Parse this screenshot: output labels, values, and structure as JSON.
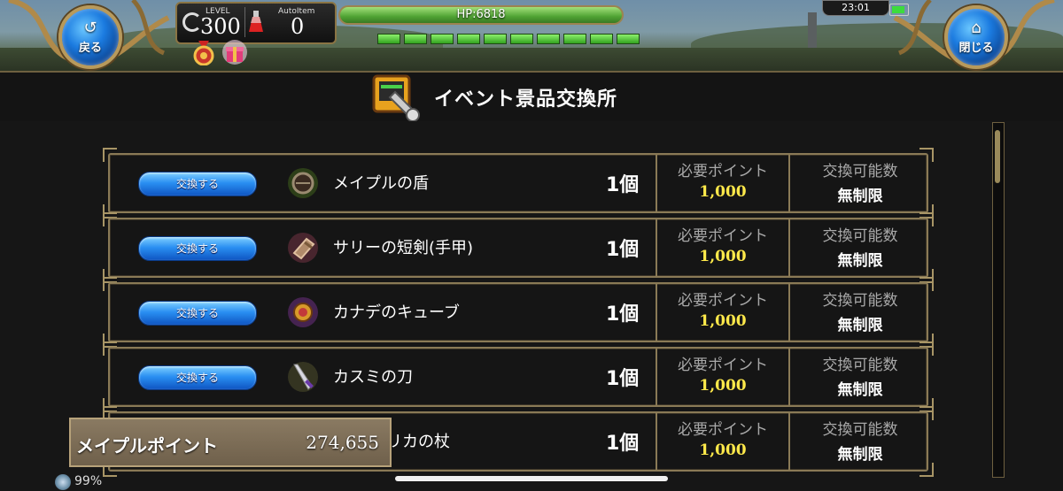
{
  "hud": {
    "back_label": "戻る",
    "close_label": "閉じる",
    "level_label": "LEVEL",
    "level_value": "300",
    "autoitem_label": "AutoItem",
    "autoitem_value": "0",
    "hp_text": "HP:6818",
    "hp_segments": 10,
    "time": "23:01"
  },
  "title": "イベント景品交換所",
  "rows": [
    {
      "button": "交換する",
      "name": "メイプルの盾",
      "qty": "1個",
      "points_header": "必要ポイント",
      "points": "1,000",
      "limit_header": "交換可能数",
      "limit": "無制限",
      "icon": "shield-icon"
    },
    {
      "button": "交換する",
      "name": "サリーの短剣(手甲)",
      "qty": "1個",
      "points_header": "必要ポイント",
      "points": "1,000",
      "limit_header": "交換可能数",
      "limit": "無制限",
      "icon": "gauntlet-icon"
    },
    {
      "button": "交換する",
      "name": "カナデのキューブ",
      "qty": "1個",
      "points_header": "必要ポイント",
      "points": "1,000",
      "limit_header": "交換可能数",
      "limit": "無制限",
      "icon": "cube-icon"
    },
    {
      "button": "交換する",
      "name": "カスミの刀",
      "qty": "1個",
      "points_header": "必要ポイント",
      "points": "1,000",
      "limit_header": "交換可能数",
      "limit": "無制限",
      "icon": "katana-icon"
    },
    {
      "button": "",
      "name": "リカの杖",
      "qty": "1個",
      "points_header": "必要ポイント",
      "points": "1,000",
      "limit_header": "交換可能数",
      "limit": "無制限",
      "icon": "staff-icon"
    }
  ],
  "points_box": {
    "label": "メイプルポイント",
    "value": "274,655"
  },
  "footer": {
    "percent": "99%"
  },
  "colors": {
    "points_value": "#ffe94a",
    "button_blue": "#2a8ff2",
    "frame_gold": "#8a7a56"
  }
}
